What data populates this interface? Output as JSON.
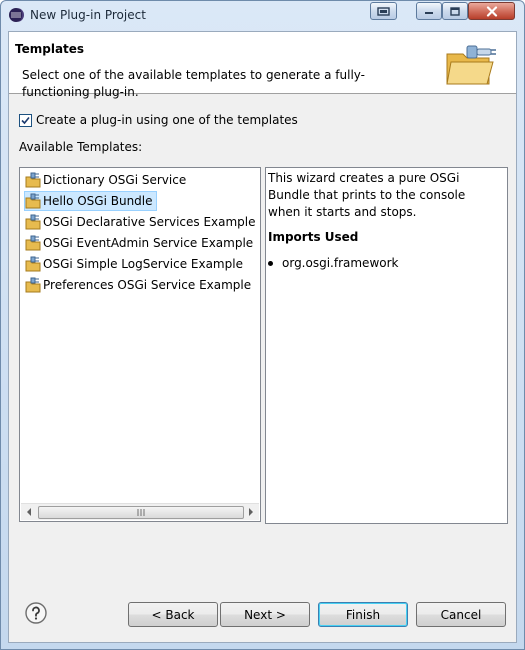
{
  "window": {
    "title": "New Plug-in Project"
  },
  "header": {
    "title": "Templates",
    "description": "Select one of the available templates to generate a fully-functioning plug-in."
  },
  "create_checkbox": {
    "label": "Create a plug-in using one of the templates",
    "checked": true
  },
  "available_label": "Available Templates:",
  "templates": [
    {
      "label": "Dictionary OSGi Service",
      "selected": false
    },
    {
      "label": "Hello OSGi Bundle",
      "selected": true
    },
    {
      "label": "OSGi Declarative Services Example",
      "selected": false
    },
    {
      "label": "OSGi EventAdmin Service Example",
      "selected": false
    },
    {
      "label": "OSGi Simple LogService Example",
      "selected": false
    },
    {
      "label": "Preferences OSGi Service Example",
      "selected": false
    }
  ],
  "description_panel": {
    "text": "This wizard creates a pure OSGi Bundle that prints to the console when it starts and stops.",
    "imports_title": "Imports Used",
    "imports": [
      "org.osgi.framework"
    ]
  },
  "buttons": {
    "back": "< Back",
    "next": "Next >",
    "finish": "Finish",
    "cancel": "Cancel"
  },
  "icons": {
    "help": "help-icon",
    "template": "plugin-template-icon"
  },
  "colors": {
    "selection": "#cce8ff",
    "title_bar": "#c4d8ee",
    "close_button": "#c9513d"
  }
}
